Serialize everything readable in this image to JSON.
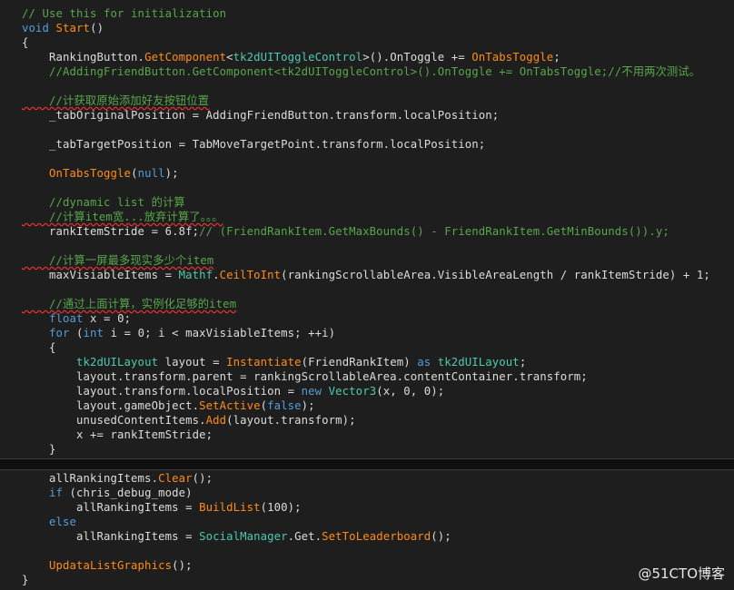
{
  "colors": {
    "default": "#dcdcdc",
    "keyword": "#569cd6",
    "comment": "#57a64a",
    "method": "#ff8c1a",
    "type": "#4ec9b0"
  },
  "code_lines": [
    {
      "tokens": [
        {
          "t": "// Use this for initialization",
          "c": "comment"
        }
      ]
    },
    {
      "tokens": [
        {
          "t": "void ",
          "c": "keyword"
        },
        {
          "t": "Start",
          "c": "method"
        },
        {
          "t": "()",
          "c": "default"
        }
      ]
    },
    {
      "tokens": [
        {
          "t": "{",
          "c": "default"
        }
      ]
    },
    {
      "tokens": [
        {
          "t": "    RankingButton.",
          "c": "default"
        },
        {
          "t": "GetComponent",
          "c": "method"
        },
        {
          "t": "<",
          "c": "default"
        },
        {
          "t": "tk2dUIToggleControl",
          "c": "type"
        },
        {
          "t": ">().",
          "c": "default"
        },
        {
          "t": "OnToggle",
          "c": "default"
        },
        {
          "t": " += ",
          "c": "default"
        },
        {
          "t": "OnTabsToggle",
          "c": "method"
        },
        {
          "t": ";",
          "c": "default"
        }
      ]
    },
    {
      "tokens": [
        {
          "t": "    //AddingFriendButton.GetComponent<tk2dUIToggleControl>().OnToggle += OnTabsToggle;//不用两次测试。",
          "c": "comment"
        }
      ]
    },
    {
      "tokens": [
        {
          "t": "",
          "c": "default"
        }
      ]
    },
    {
      "tokens": [
        {
          "t": "    //计获取原始添加好友按钮位置",
          "c": "comment",
          "sq": true
        }
      ]
    },
    {
      "tokens": [
        {
          "t": "    _tabOriginalPosition = AddingFriendButton.transform.localPosition;",
          "c": "default"
        }
      ]
    },
    {
      "tokens": [
        {
          "t": "",
          "c": "default"
        }
      ]
    },
    {
      "tokens": [
        {
          "t": "    _tabTargetPosition = TabMoveTargetPoint.transform.localPosition;",
          "c": "default"
        }
      ]
    },
    {
      "tokens": [
        {
          "t": "",
          "c": "default"
        }
      ]
    },
    {
      "tokens": [
        {
          "t": "    ",
          "c": "default"
        },
        {
          "t": "OnTabsToggle",
          "c": "method"
        },
        {
          "t": "(",
          "c": "default"
        },
        {
          "t": "null",
          "c": "keyword"
        },
        {
          "t": ");",
          "c": "default"
        }
      ]
    },
    {
      "tokens": [
        {
          "t": "",
          "c": "default"
        }
      ]
    },
    {
      "tokens": [
        {
          "t": "    //dynamic list 的计算",
          "c": "comment"
        }
      ]
    },
    {
      "tokens": [
        {
          "t": "    //计算item宽...放弃计算了。。。",
          "c": "comment",
          "sq": true
        }
      ]
    },
    {
      "tokens": [
        {
          "t": "    rankItemStride = 6.8f;",
          "c": "default"
        },
        {
          "t": "// (FriendRankItem.GetMaxBounds() - FriendRankItem.GetMinBounds()).y;",
          "c": "comment"
        }
      ]
    },
    {
      "tokens": [
        {
          "t": "",
          "c": "default"
        }
      ]
    },
    {
      "tokens": [
        {
          "t": "    //计算一屏最多现实多少个item",
          "c": "comment",
          "sq": true
        }
      ]
    },
    {
      "tokens": [
        {
          "t": "    maxVisiableItems = ",
          "c": "default"
        },
        {
          "t": "Mathf",
          "c": "type"
        },
        {
          "t": ".",
          "c": "default"
        },
        {
          "t": "CeilToInt",
          "c": "method"
        },
        {
          "t": "(rankingScrollableArea.VisibleAreaLength / rankItemStride) + 1;",
          "c": "default"
        }
      ]
    },
    {
      "tokens": [
        {
          "t": "",
          "c": "default"
        }
      ]
    },
    {
      "tokens": [
        {
          "t": "    //通过上面计算，实例化足够的item",
          "c": "comment",
          "sq": true
        }
      ]
    },
    {
      "tokens": [
        {
          "t": "    ",
          "c": "default"
        },
        {
          "t": "float",
          "c": "keyword"
        },
        {
          "t": " x = 0;",
          "c": "default"
        }
      ]
    },
    {
      "tokens": [
        {
          "t": "    ",
          "c": "default"
        },
        {
          "t": "for",
          "c": "keyword"
        },
        {
          "t": " (",
          "c": "default"
        },
        {
          "t": "int",
          "c": "keyword"
        },
        {
          "t": " i = 0; i < maxVisiableItems; ++i)",
          "c": "default"
        }
      ]
    },
    {
      "tokens": [
        {
          "t": "    {",
          "c": "default"
        }
      ]
    },
    {
      "tokens": [
        {
          "t": "        ",
          "c": "default"
        },
        {
          "t": "tk2dUILayout",
          "c": "type"
        },
        {
          "t": " layout = ",
          "c": "default"
        },
        {
          "t": "Instantiate",
          "c": "method"
        },
        {
          "t": "(FriendRankItem) ",
          "c": "default"
        },
        {
          "t": "as",
          "c": "keyword"
        },
        {
          "t": " ",
          "c": "default"
        },
        {
          "t": "tk2dUILayout",
          "c": "type"
        },
        {
          "t": ";",
          "c": "default"
        }
      ]
    },
    {
      "tokens": [
        {
          "t": "        layout.transform.parent = rankingScrollableArea.contentContainer.transform;",
          "c": "default"
        }
      ]
    },
    {
      "tokens": [
        {
          "t": "        layout.transform.localPosition = ",
          "c": "default"
        },
        {
          "t": "new",
          "c": "keyword"
        },
        {
          "t": " ",
          "c": "default"
        },
        {
          "t": "Vector3",
          "c": "type"
        },
        {
          "t": "(x, 0, 0);",
          "c": "default"
        }
      ]
    },
    {
      "tokens": [
        {
          "t": "        layout.gameObject.",
          "c": "default"
        },
        {
          "t": "SetActive",
          "c": "method"
        },
        {
          "t": "(",
          "c": "default"
        },
        {
          "t": "false",
          "c": "keyword"
        },
        {
          "t": ");",
          "c": "default"
        }
      ]
    },
    {
      "tokens": [
        {
          "t": "        unusedContentItems.",
          "c": "default"
        },
        {
          "t": "Add",
          "c": "method"
        },
        {
          "t": "(layout.transform);",
          "c": "default"
        }
      ]
    },
    {
      "tokens": [
        {
          "t": "        x += rankItemStride;",
          "c": "default"
        }
      ]
    },
    {
      "tokens": [
        {
          "t": "    }",
          "c": "default"
        }
      ]
    }
  ],
  "code_lines_bottom": [
    {
      "tokens": [
        {
          "t": "    allRankingItems.",
          "c": "default"
        },
        {
          "t": "Clear",
          "c": "method"
        },
        {
          "t": "();",
          "c": "default"
        }
      ]
    },
    {
      "tokens": [
        {
          "t": "    ",
          "c": "default"
        },
        {
          "t": "if",
          "c": "keyword"
        },
        {
          "t": " (chris_debug_mode)",
          "c": "default"
        }
      ]
    },
    {
      "tokens": [
        {
          "t": "        allRankingItems = ",
          "c": "default"
        },
        {
          "t": "BuildList",
          "c": "method"
        },
        {
          "t": "(100);",
          "c": "default"
        }
      ]
    },
    {
      "tokens": [
        {
          "t": "    ",
          "c": "default"
        },
        {
          "t": "else",
          "c": "keyword"
        }
      ]
    },
    {
      "tokens": [
        {
          "t": "        allRankingItems = ",
          "c": "default"
        },
        {
          "t": "SocialManager",
          "c": "type"
        },
        {
          "t": ".Get.",
          "c": "default"
        },
        {
          "t": "SetToLeaderboard",
          "c": "method"
        },
        {
          "t": "();",
          "c": "default"
        }
      ]
    },
    {
      "tokens": [
        {
          "t": "",
          "c": "default"
        }
      ]
    },
    {
      "tokens": [
        {
          "t": "    ",
          "c": "default"
        },
        {
          "t": "UpdataListGraphics",
          "c": "method"
        },
        {
          "t": "();",
          "c": "default"
        }
      ]
    },
    {
      "tokens": [
        {
          "t": "}",
          "c": "default"
        }
      ]
    }
  ],
  "watermark": "@51CTO博客"
}
